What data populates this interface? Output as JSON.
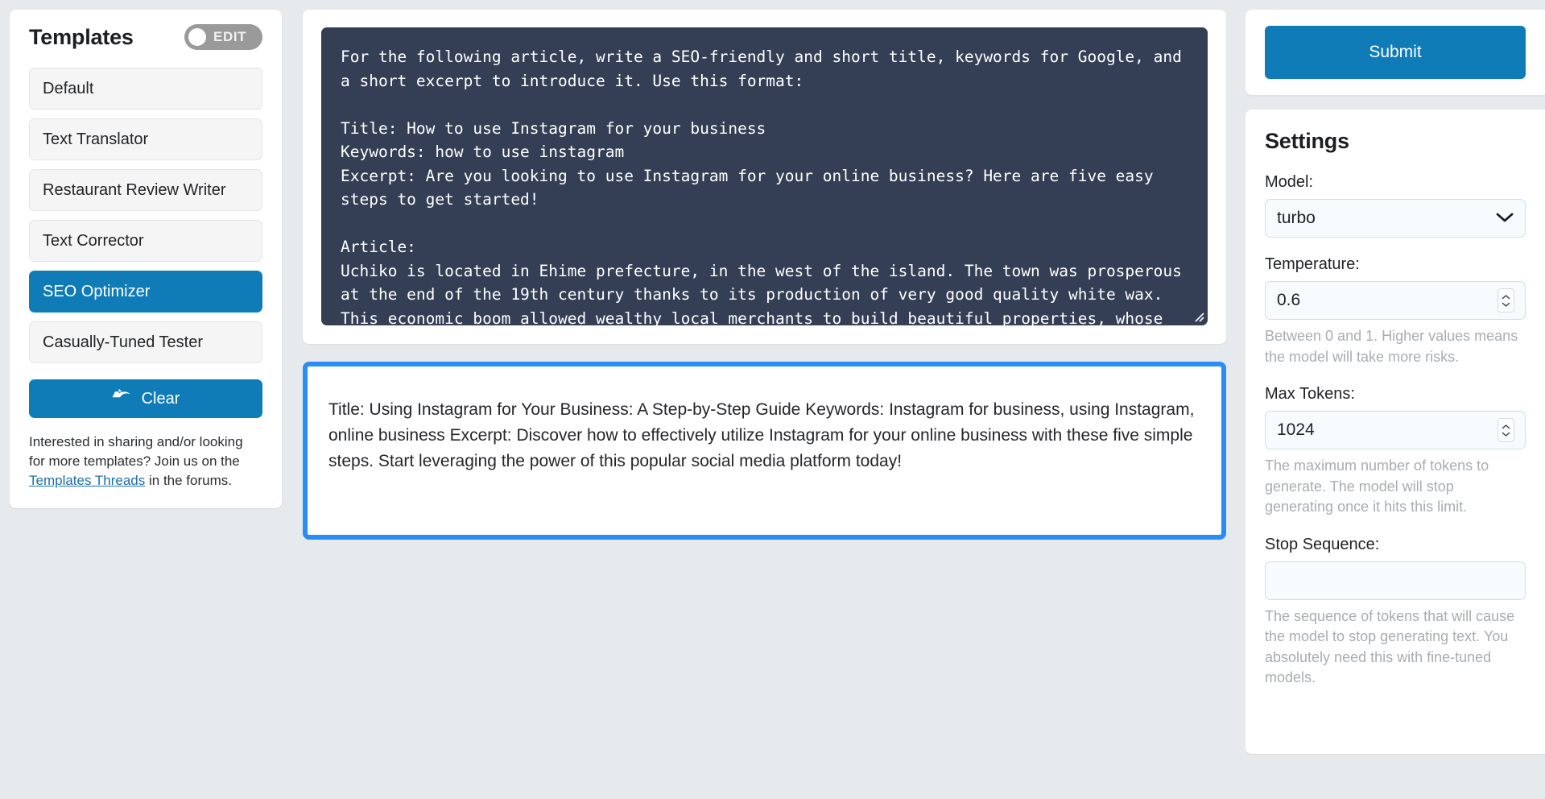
{
  "sidebar": {
    "title": "Templates",
    "edit_toggle": {
      "label": "EDIT",
      "state": "off"
    },
    "items": [
      {
        "label": "Default",
        "selected": false
      },
      {
        "label": "Text Translator",
        "selected": false
      },
      {
        "label": "Restaurant Review Writer",
        "selected": false
      },
      {
        "label": "Text Corrector",
        "selected": false
      },
      {
        "label": "SEO Optimizer",
        "selected": true
      },
      {
        "label": "Casually-Tuned Tester",
        "selected": false
      }
    ],
    "clear_button": {
      "label": "Clear",
      "icon": "undo-icon"
    },
    "footer": {
      "text_before": "Interested in sharing and/or looking for more templates? Join us on the ",
      "link_text": "Templates Threads",
      "text_after": " in the forums."
    }
  },
  "main": {
    "prompt_value": "For the following article, write a SEO-friendly and short title, keywords for Google, and a short excerpt to introduce it. Use this format:\n\nTitle: How to use Instagram for your business\nKeywords: how to use instagram\nExcerpt: Are you looking to use Instagram for your online business? Here are five easy steps to get started!\n\nArticle:\nUchiko is located in Ehime prefecture, in the west of the island. The town was prosperous at the end of the 19th century thanks to its production of very good quality white wax. This economic boom allowed wealthy local merchants to build beautiful properties, whose heritage is still visible",
    "output_value": "Title: Using Instagram for Your Business: A Step-by-Step Guide Keywords: Instagram for business, using Instagram, online business Excerpt: Discover how to effectively utilize Instagram for your online business with these five simple steps. Start leveraging the power of this popular social media platform today!"
  },
  "right": {
    "submit_label": "Submit",
    "settings_title": "Settings",
    "model": {
      "label": "Model:",
      "value": "turbo"
    },
    "temperature": {
      "label": "Temperature:",
      "value": "0.6",
      "help": "Between 0 and 1. Higher values means the model will take more risks."
    },
    "max_tokens": {
      "label": "Max Tokens:",
      "value": "1024",
      "help": "The maximum number of tokens to generate. The model will stop generating once it hits this limit."
    },
    "stop_sequence": {
      "label": "Stop Sequence:",
      "value": "",
      "help": "The sequence of tokens that will cause the model to stop generating text. You absolutely need this with fine-tuned models."
    }
  },
  "colors": {
    "page_bg": "#e6eaed",
    "accent_blue": "#0f7cb8",
    "focus_blue": "#2a8cf5",
    "prompt_bg": "#343f55",
    "toggle_gray": "#9a9a9a",
    "help_gray": "#a8adb3"
  }
}
